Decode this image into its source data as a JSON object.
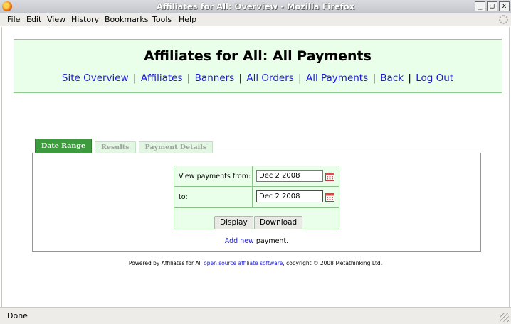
{
  "window": {
    "title": "Affiliates for All: Overview - Mozilla Firefox",
    "buttons": {
      "minimize": "_",
      "maximize": "□",
      "close": "x"
    }
  },
  "menubar": {
    "items": [
      {
        "label": "File",
        "accel": "F",
        "rest": "ile"
      },
      {
        "label": "Edit",
        "accel": "E",
        "rest": "dit"
      },
      {
        "label": "View",
        "accel": "V",
        "rest": "iew"
      },
      {
        "label": "History",
        "accel": "H",
        "rest": "istory"
      },
      {
        "label": "Bookmarks",
        "accel": "B",
        "rest": "ookmarks"
      },
      {
        "label": "Tools",
        "accel": "T",
        "rest": "ools"
      },
      {
        "label": "Help",
        "accel": "H",
        "rest": "elp"
      }
    ]
  },
  "header": {
    "title": "Affiliates for All: All Payments",
    "nav": [
      "Site Overview",
      "Affiliates",
      "Banners",
      "All Orders",
      "All Payments",
      "Back",
      "Log Out"
    ],
    "separator": "|"
  },
  "tabs": [
    {
      "label": "Date Range",
      "active": true
    },
    {
      "label": "Results",
      "active": false
    },
    {
      "label": "Payment Details",
      "active": false
    }
  ],
  "form": {
    "from_label": "View payments from:",
    "from_value": "Dec 2 2008",
    "to_label": "to:",
    "to_value": "Dec 2 2008",
    "display_button": "Display",
    "download_button": "Download"
  },
  "add_payment": {
    "link": "Add new",
    "suffix": " payment."
  },
  "footer": {
    "prefix": "Powered by Affiliates for All ",
    "link": "open source affiliate software",
    "suffix": ", copyright © 2008 Metathinking Ltd."
  },
  "status": {
    "text": "Done"
  },
  "colors": {
    "tab_active": "#3e9a3e",
    "panel_border": "#6bb56b",
    "header_band": "#eaffea",
    "link": "#1a1ad6"
  }
}
